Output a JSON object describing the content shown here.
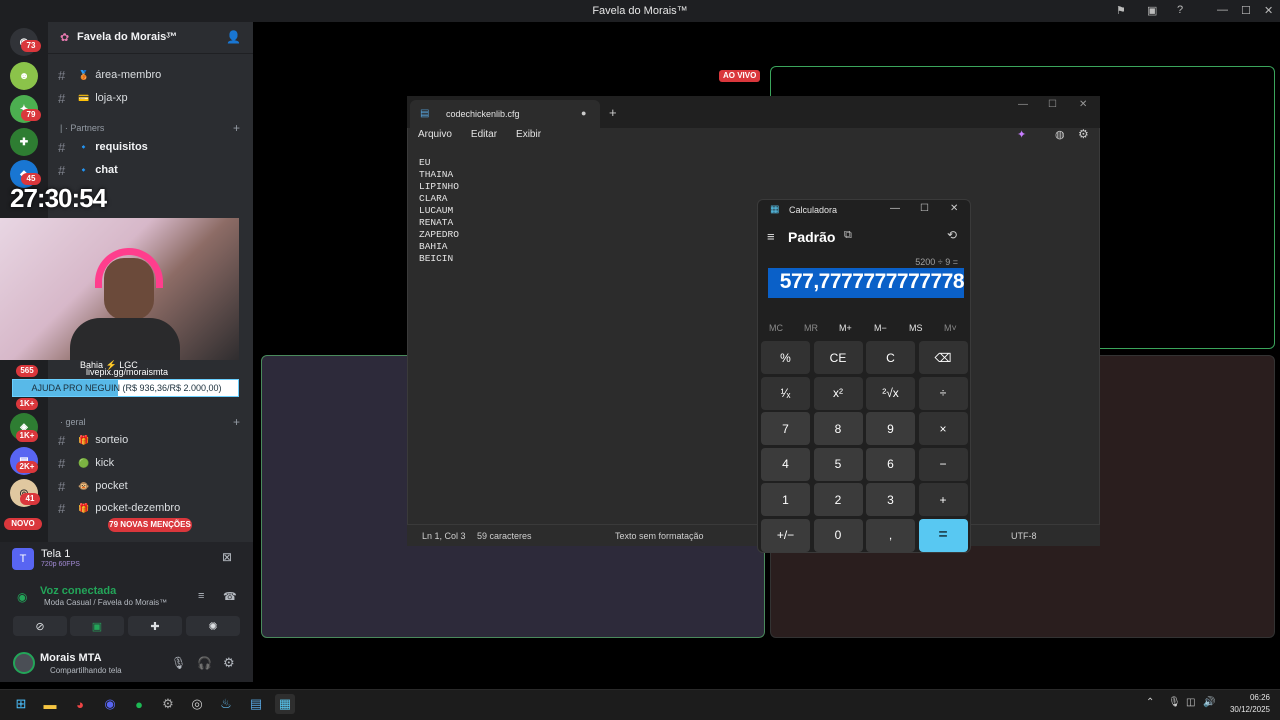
{
  "window": {
    "title": "Favela do Morais™"
  },
  "server": {
    "name": "Favela do Morais™"
  },
  "rail_badges": [
    "73",
    "79",
    "45",
    "565",
    "1K+",
    "1K+",
    "2K+",
    "41"
  ],
  "rail_novo": "NOVO",
  "channels_top": [
    {
      "name": "área-membro",
      "emoji": "🥉"
    },
    {
      "name": "loja-xp",
      "emoji": "💳"
    }
  ],
  "category_partners": "| · Partners",
  "channels_partners": [
    {
      "name": "requisitos",
      "emoji": "🔹"
    },
    {
      "name": "chat",
      "emoji": "🔹"
    }
  ],
  "category_geral": "· geral",
  "channels_geral": [
    {
      "name": "sorteio",
      "emoji": "🎁"
    },
    {
      "name": "kick",
      "emoji": "🟢"
    },
    {
      "name": "pocket",
      "emoji": "🐵"
    },
    {
      "name": "pocket-dezembro",
      "emoji": "🎁"
    }
  ],
  "mentions_badge": "79 NOVAS MENÇÕES",
  "stream": {
    "clock": "27:30:54",
    "cam_name": "Bahia",
    "cam_tag": "LGC",
    "livepix": "livepix.gg/moraismta",
    "donation_text": "AJUDA PRO NEGUIN (R$ 936,36/R$ 2.000,00)",
    "donation_progress": 0.468
  },
  "voice": {
    "screen_label": "Tela 1",
    "quality": "720p 60FPS",
    "status": "Voz conectada",
    "channel": "Moda Casual / Favela do Morais™"
  },
  "user": {
    "name": "Morais MTA",
    "status": "Compartilhando tela"
  },
  "main": {
    "live_badge": "AO VIVO"
  },
  "notepad": {
    "tab_title": "codechickenlib.cfg",
    "menu": [
      "Arquivo",
      "Editar",
      "Exibir"
    ],
    "lines": [
      "EU",
      "THAINA",
      "LIPINHO",
      "CLARA",
      "LUCAUM",
      "RENATA",
      "ZAPEDRO",
      "BAHIA",
      "BEICIN"
    ],
    "status_pos": "Ln 1, Col 3",
    "status_chars": "59 caracteres",
    "status_format": "Texto sem formatação",
    "status_encoding": "UTF-8"
  },
  "calculator": {
    "title": "Calculadora",
    "mode": "Padrão",
    "expression": "5200 ÷ 9 =",
    "result": "577,7777777777778",
    "memory": [
      "MC",
      "MR",
      "M+",
      "M−",
      "MS",
      "M˅"
    ],
    "keys": [
      [
        "%",
        "CE",
        "C",
        "⌫"
      ],
      [
        "¹⁄ₓ",
        "x²",
        "²√x",
        "÷"
      ],
      [
        "7",
        "8",
        "9",
        "×"
      ],
      [
        "4",
        "5",
        "6",
        "−"
      ],
      [
        "1",
        "2",
        "3",
        "+"
      ],
      [
        "+/−",
        "0",
        ",",
        "="
      ]
    ]
  },
  "taskbar": {
    "time": "06:26",
    "date": "30/12/2025"
  },
  "colors": {
    "accent": "#58c8f2",
    "live": "#da373c",
    "voice_green": "#23a559",
    "tile_border": "#3ba55c"
  }
}
